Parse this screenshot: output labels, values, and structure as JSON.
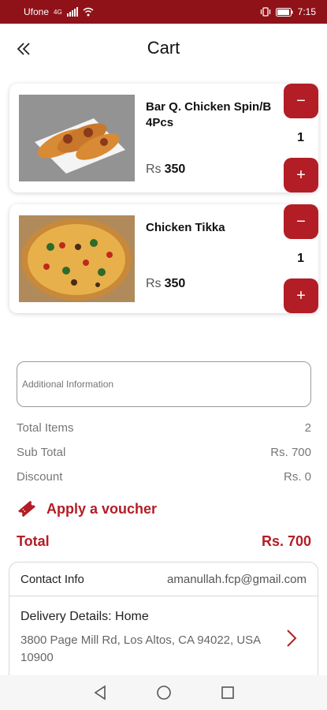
{
  "status_bar": {
    "carrier": "Ufone",
    "network": "4G",
    "time": "7:15"
  },
  "header": {
    "title": "Cart",
    "back_icon": "double-chevron-left-icon"
  },
  "cart": {
    "items": [
      {
        "name": "Bar Q. Chicken Spin/B 4Pcs",
        "currency": "Rs",
        "price": "350",
        "quantity": "1",
        "minus": "−",
        "plus": "+"
      },
      {
        "name": "Chicken Tikka",
        "currency": "Rs",
        "price": "350",
        "quantity": "1",
        "minus": "−",
        "plus": "+"
      }
    ]
  },
  "additional_info": {
    "placeholder": "Additional Information"
  },
  "summary": {
    "total_items_label": "Total Items",
    "total_items_value": "2",
    "sub_total_label": "Sub Total",
    "sub_total_value": "Rs. 700",
    "discount_label": "Discount",
    "discount_value": "Rs. 0"
  },
  "voucher": {
    "label": "Apply a voucher"
  },
  "total": {
    "label": "Total",
    "value": "Rs. 700"
  },
  "contact": {
    "label": "Contact Info",
    "email": "amanullah.fcp@gmail.com",
    "delivery_title": "Delivery Details: Home",
    "delivery_address": "3800 Page Mill Rd, Los Altos, CA 94022, USA 10900"
  },
  "colors": {
    "brand": "#b31d25",
    "status_bar": "#8f1219"
  }
}
